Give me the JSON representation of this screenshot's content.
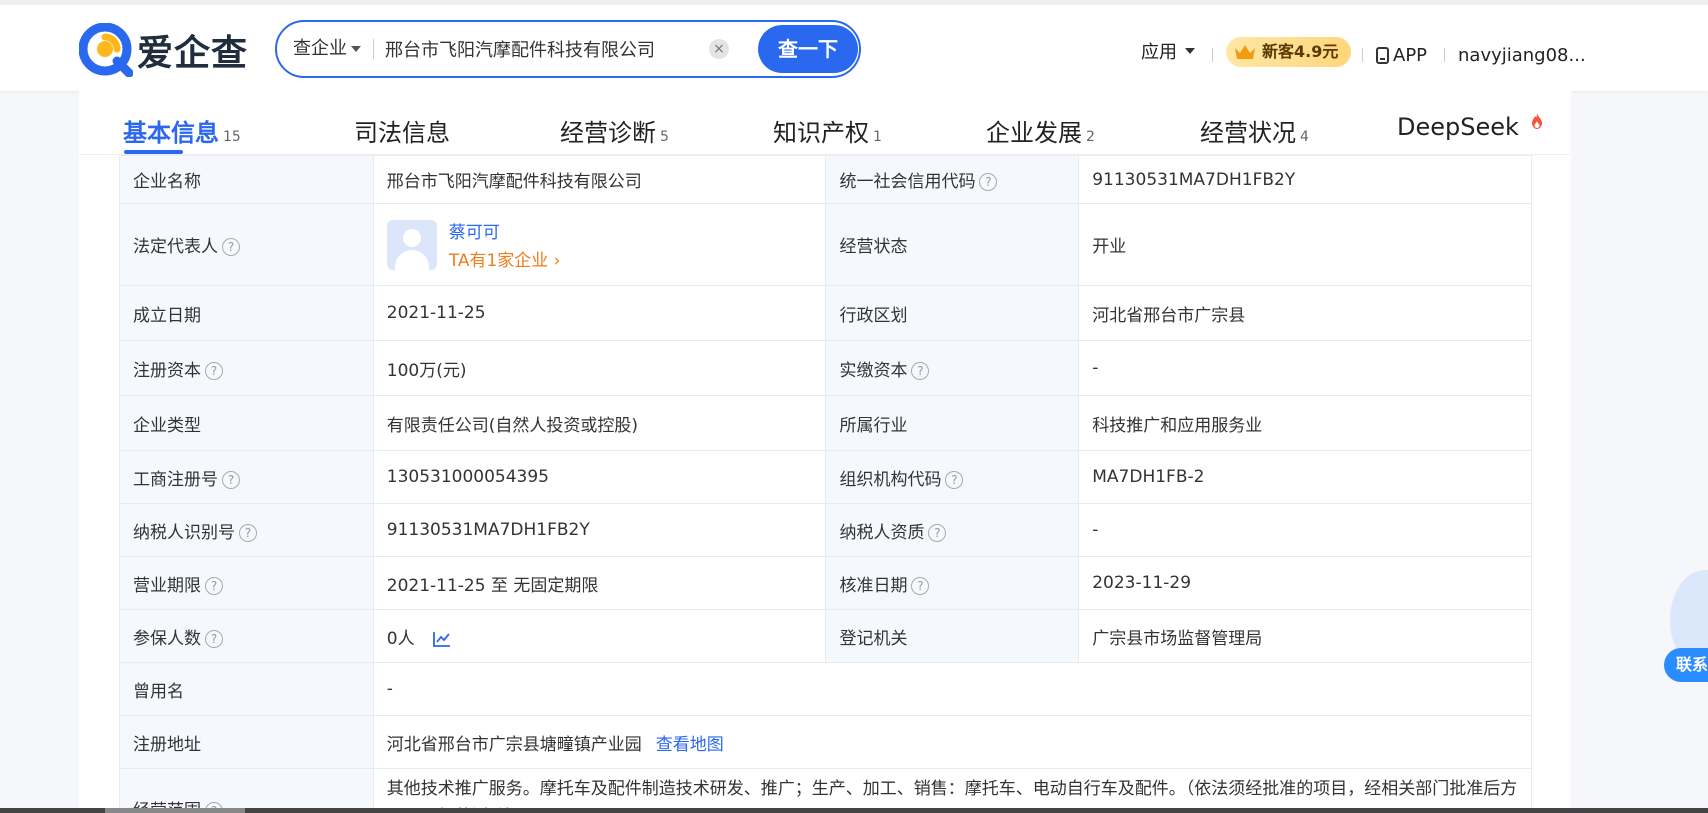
{
  "header": {
    "logo_text": "爱企查",
    "search": {
      "type_label": "查企业",
      "value": "邢台市飞阳汽摩配件科技有限公司",
      "clear_symbol": "×",
      "button_label": "查一下"
    },
    "apps_label": "应用",
    "new_user_badge": "新客4.9元",
    "app_label": "APP",
    "username": "navyjiang08..."
  },
  "tabs": [
    {
      "label": "基本信息",
      "count": "15"
    },
    {
      "label": "司法信息",
      "count": ""
    },
    {
      "label": "经营诊断",
      "count": "5"
    },
    {
      "label": "知识产权",
      "count": "1"
    },
    {
      "label": "企业发展",
      "count": "2"
    },
    {
      "label": "经营状况",
      "count": "4"
    },
    {
      "label": "DeepSeek",
      "count": ""
    }
  ],
  "info": {
    "company_name_label": "企业名称",
    "company_name": "邢台市飞阳汽摩配件科技有限公司",
    "credit_code_label": "统一社会信用代码",
    "credit_code": "91130531MA7DH1FB2Y",
    "legal_rep_label": "法定代表人",
    "legal_rep_name": "蔡可可",
    "legal_rep_sub": "TA有1家企业 ›",
    "status_label": "经营状态",
    "status": "开业",
    "founded_label": "成立日期",
    "founded": "2021-11-25",
    "region_label": "行政区划",
    "region": "河北省邢台市广宗县",
    "reg_capital_label": "注册资本",
    "reg_capital": "100万(元)",
    "paid_capital_label": "实缴资本",
    "paid_capital": "-",
    "type_label": "企业类型",
    "type": "有限责任公司(自然人投资或控股)",
    "industry_label": "所属行业",
    "industry": "科技推广和应用服务业",
    "biz_reg_no_label": "工商注册号",
    "biz_reg_no": "130531000054395",
    "org_code_label": "组织机构代码",
    "org_code": "MA7DH1FB-2",
    "taxpayer_id_label": "纳税人识别号",
    "taxpayer_id": "91130531MA7DH1FB2Y",
    "taxpayer_qual_label": "纳税人资质",
    "taxpayer_qual": "-",
    "biz_term_label": "营业期限",
    "biz_term": "2021-11-25 至 无固定期限",
    "approval_date_label": "核准日期",
    "approval_date": "2023-11-29",
    "insured_label": "参保人数",
    "insured": "0人",
    "authority_label": "登记机关",
    "authority": "广宗县市场监督管理局",
    "former_name_label": "曾用名",
    "former_name": "-",
    "address_label": "注册地址",
    "address": "河北省邢台市广宗县塘疃镇产业园",
    "view_map": "查看地图",
    "scope_label": "经营范围",
    "scope": "其他技术推广服务。摩托车及配件制造技术研发、推广；生产、加工、销售：摩托车、电动自行车及配件。（依法须经批准的项目，经相关部门批准后方可开展经营活动）**",
    "help_symbol": "?"
  },
  "float_widget_label": "联系",
  "colors": {
    "brand_blue": "#2b68f0",
    "orange": "#f07d1c",
    "label_bg": "#f5f8fd"
  }
}
